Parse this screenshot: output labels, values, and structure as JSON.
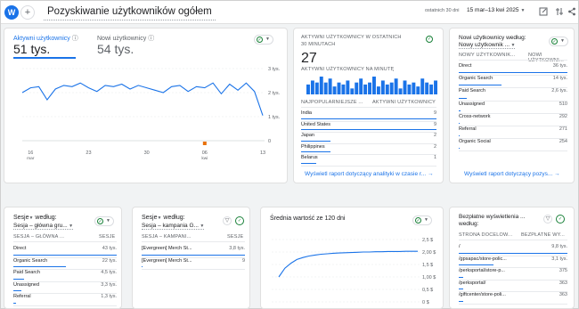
{
  "header": {
    "avatar_letter": "W",
    "add_symbol": "+",
    "title": "Pozyskiwanie użytkowników ogółem",
    "period_label": "ostatnich 30 dni",
    "date_range": "15 mar–13 kwi 2025"
  },
  "overview": {
    "metric1_label": "Aktywni użytkownicy",
    "metric1_value": "51 tys.",
    "metric2_label": "Nowi użytkownicy",
    "metric2_value": "54 tys.",
    "y_ticks": [
      "3 tys.",
      "2 tys.",
      "1 tys.",
      "0"
    ],
    "x_ticks": [
      "16\nmar",
      "23",
      "30",
      "06\nkwi",
      "13"
    ],
    "chart_data": {
      "type": "line",
      "ylim": [
        0,
        3000
      ],
      "series": [
        {
          "name": "Aktywni użytkownicy",
          "color": "#1a73e8",
          "values": [
            2000,
            2200,
            2250,
            1700,
            2150,
            2300,
            2250,
            2400,
            2200,
            2050,
            2300,
            2250,
            2350,
            2150,
            2300,
            2200,
            2100,
            2000,
            2250,
            2300,
            2050,
            2250,
            2200,
            2400,
            1950,
            2350,
            2100,
            2400,
            2050,
            1050
          ]
        }
      ]
    }
  },
  "realtime": {
    "title_line1": "AKTYWNI UŻYTKOWNICY W OSTATNICH",
    "title_line2": "30 MINUTACH",
    "value": "27",
    "per_minute_label": "AKTYWNI UŻYTKOWNICY NA MINUTĘ",
    "bars": [
      5,
      7,
      6,
      9,
      6,
      8,
      4,
      6,
      5,
      7,
      3,
      6,
      8,
      5,
      6,
      9,
      4,
      7,
      5,
      6,
      8,
      3,
      7,
      5,
      6,
      4,
      8,
      6,
      5,
      7
    ],
    "col1": "NAJPOPULARNIEJSZE ...",
    "col2": "AKTYWNI UŻYTKOWNICY",
    "rows": [
      {
        "label": "India",
        "value": "9",
        "fill": 1.0
      },
      {
        "label": "United States",
        "value": "9",
        "fill": 1.0
      },
      {
        "label": "Japan",
        "value": "2",
        "fill": 0.22
      },
      {
        "label": "Philippines",
        "value": "2",
        "fill": 0.22
      },
      {
        "label": "Belarus",
        "value": "1",
        "fill": 0.11
      }
    ],
    "link": "Wyświetl raport dotyczący analityki w czasie r..."
  },
  "new_users": {
    "title": "Nowi użytkownicy według:",
    "dimension": "Nowy użytkownik ...",
    "col1": "NOWY UŻYTKOWNIK...",
    "col2": "NOWI UŻYTKOWNI...",
    "rows": [
      {
        "label": "Direct",
        "value": "36 tys.",
        "fill": 1.0
      },
      {
        "label": "Organic Search",
        "value": "14 tys.",
        "fill": 0.39
      },
      {
        "label": "Paid Search",
        "value": "2,6 tys.",
        "fill": 0.07
      },
      {
        "label": "Unassigned",
        "value": "510",
        "fill": 0.02
      },
      {
        "label": "Cross-network",
        "value": "292",
        "fill": 0.01
      },
      {
        "label": "Referral",
        "value": "271",
        "fill": 0.01
      },
      {
        "label": "Organic Social",
        "value": "254",
        "fill": 0.01
      }
    ],
    "link": "Wyświetl raport dotyczący pozys..."
  },
  "sessions1": {
    "title": "Sesje",
    "title_suffix": "według:",
    "dimension": "Sesja – główna gru...",
    "col1": "SESJA – GŁÓWNA ...",
    "col2": "SESJE",
    "rows": [
      {
        "label": "Direct",
        "value": "43 tys.",
        "fill": 1.0
      },
      {
        "label": "Organic Search",
        "value": "22 tys.",
        "fill": 0.51
      },
      {
        "label": "Paid Search",
        "value": "4,5 tys.",
        "fill": 0.1
      },
      {
        "label": "Unassigned",
        "value": "3,3 tys.",
        "fill": 0.08
      },
      {
        "label": "Referral",
        "value": "1,3 tys.",
        "fill": 0.03
      }
    ]
  },
  "sessions2": {
    "title": "Sesje",
    "title_suffix": "według:",
    "dimension": "Sesja – kampania G...",
    "col1": "SESJA – KAMPANI...",
    "col2": "SESJE",
    "rows": [
      {
        "label": "[Evergreen] Merch St...",
        "value": "3,8 tys.",
        "fill": 1.0
      },
      {
        "label": "[Evergreen] Merch St...",
        "value": "9",
        "fill": 0.01
      }
    ]
  },
  "avg_value": {
    "title": "Średnia wartość ze 120 dni",
    "y_ticks": [
      "2,5 $",
      "2,00 $",
      "1,5 $",
      "1,00 $",
      "0,5 $",
      "0 $"
    ],
    "chart_data": {
      "type": "line",
      "ylim": [
        0,
        2.5
      ],
      "series": [
        {
          "color": "#1a73e8",
          "values": [
            1.0,
            1.35,
            1.55,
            1.7,
            1.78,
            1.84,
            1.88,
            1.91,
            1.93,
            1.95,
            1.96,
            1.97,
            1.98,
            1.99,
            2.0,
            2.0,
            2.01,
            2.01,
            2.02,
            2.02,
            2.02,
            2.03,
            2.03,
            2.03
          ]
        }
      ]
    }
  },
  "organic": {
    "title": "Bezpłatne wyświetlenia ...",
    "title_line2": "według:",
    "col1": "STRONA DOCELOW...",
    "col2": "BEZPŁATNE WY...",
    "rows": [
      {
        "label": "/",
        "value": "9,8 tys.",
        "fill": 1.0
      },
      {
        "label": "/gpsapac/store-polic...",
        "value": "3,1 tys.",
        "fill": 0.32
      },
      {
        "label": "/perksportal/store-p...",
        "value": "375",
        "fill": 0.04
      },
      {
        "label": "/perksportal/",
        "value": "363",
        "fill": 0.04
      },
      {
        "label": "/giftcenter/store-poli...",
        "value": "363",
        "fill": 0.04
      }
    ]
  }
}
